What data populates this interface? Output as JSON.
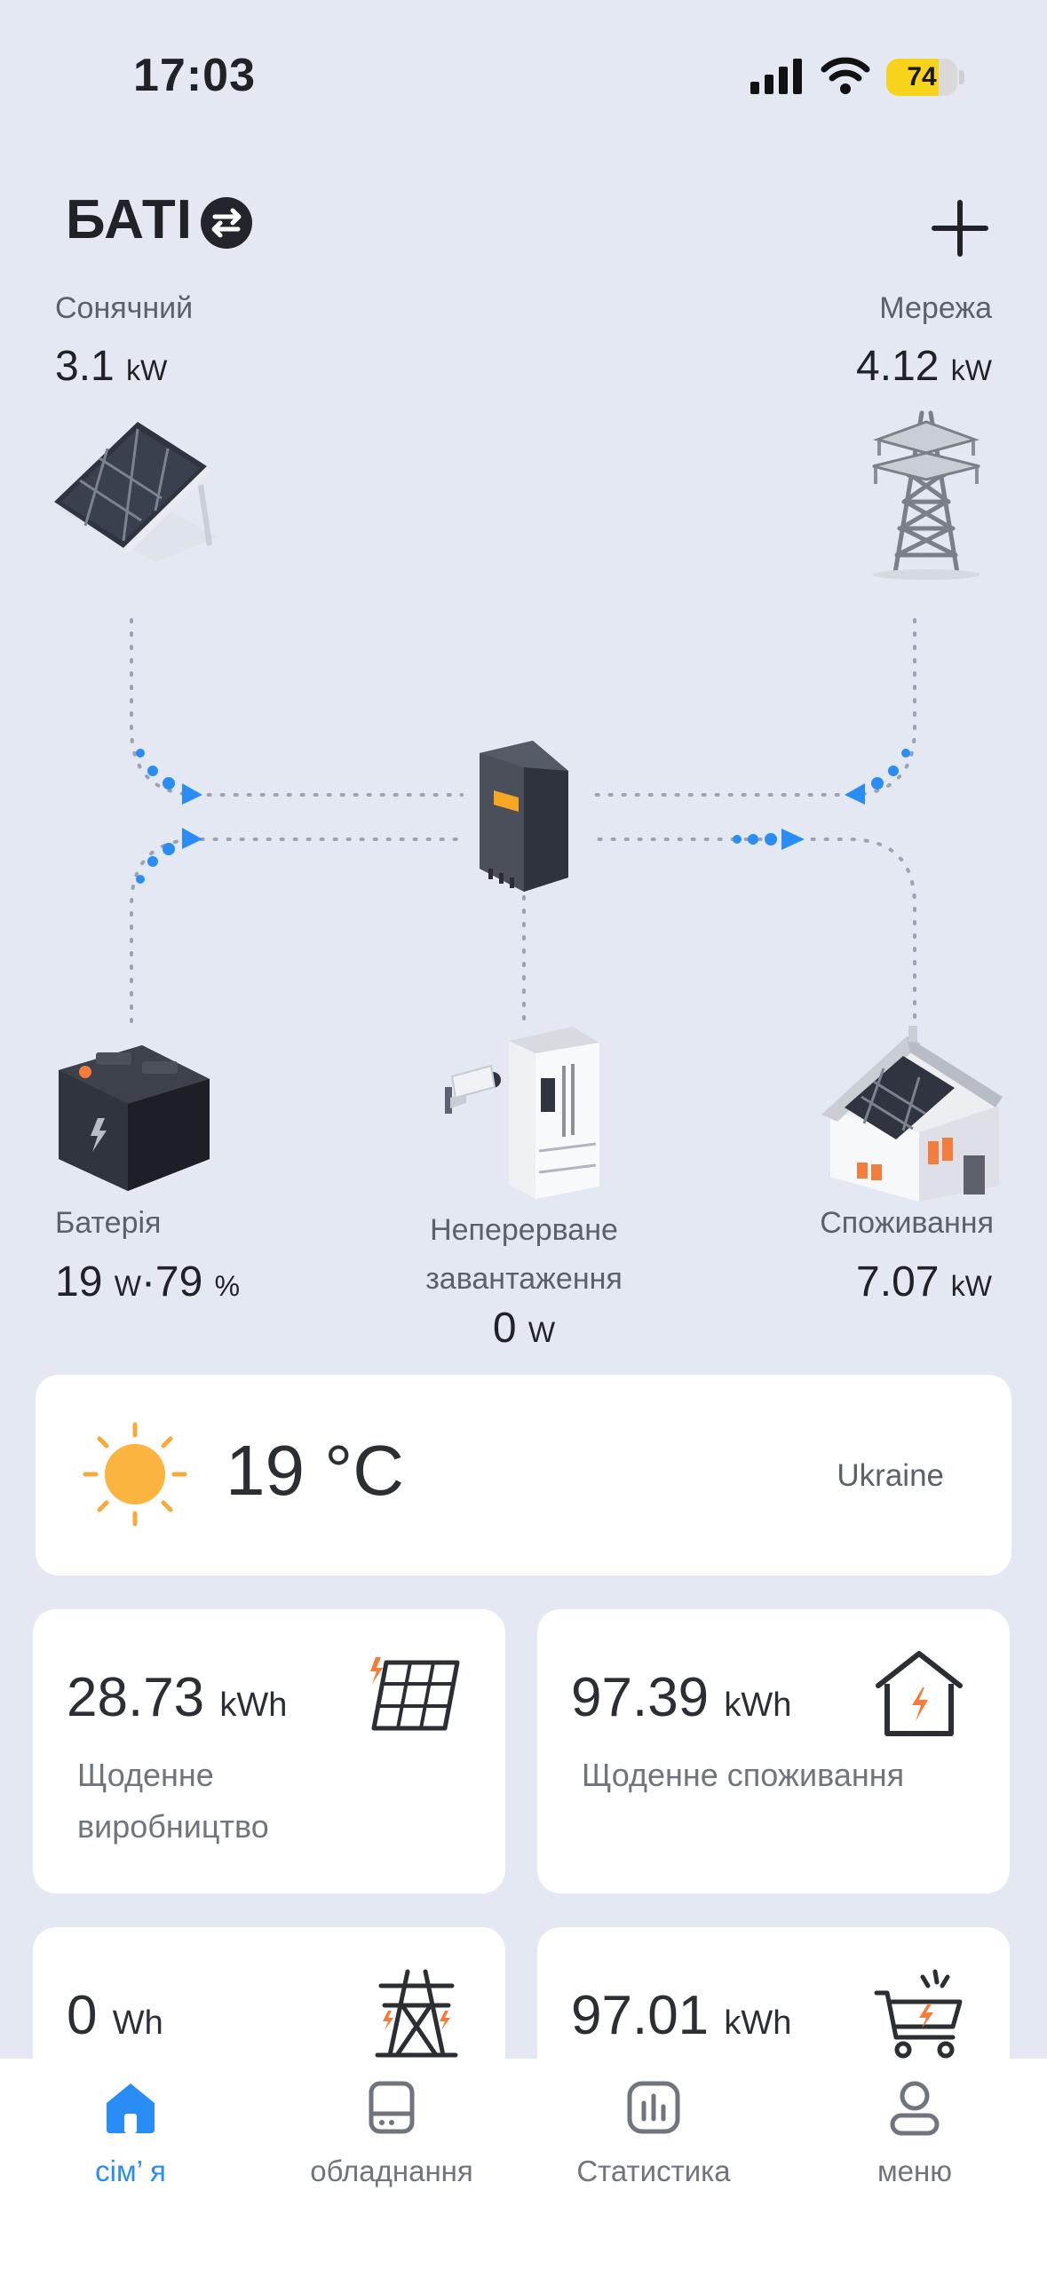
{
  "status_bar": {
    "time": "17:03",
    "battery_percent": "74"
  },
  "header": {
    "title": "БАТІ"
  },
  "flow": {
    "solar": {
      "label": "Сонячний",
      "value": "3.1",
      "unit": "kW"
    },
    "grid": {
      "label": "Мережа",
      "value": "4.12",
      "unit": "kW"
    },
    "battery": {
      "label": "Батерія",
      "power": "19",
      "power_unit": "W",
      "separator": "·",
      "soc": "79",
      "soc_unit": "%"
    },
    "ups_load": {
      "label_line1": "Неперерване",
      "label_line2": "завантаження",
      "value": "0",
      "unit": "W"
    },
    "consumption": {
      "label": "Споживання",
      "value": "7.07",
      "unit": "kW"
    }
  },
  "weather": {
    "temperature": "19 °C",
    "location": "Ukraine",
    "icon": "sun-icon"
  },
  "stats": {
    "daily_production": {
      "value": "28.73",
      "unit": "kWh",
      "label_line1": "Щоденне",
      "label_line2": "виробництво",
      "icon": "solar-panel-icon"
    },
    "daily_consumption": {
      "value": "97.39",
      "unit": "kWh",
      "label": "Щоденне споживання",
      "icon": "house-power-icon"
    },
    "grid_energy": {
      "value": "0",
      "unit": "Wh",
      "icon": "power-tower-icon"
    },
    "purchased_energy": {
      "value": "97.01",
      "unit": "kWh",
      "icon": "cart-power-icon"
    }
  },
  "tabs": [
    {
      "label": "сім’ я",
      "icon": "home-icon",
      "active": true
    },
    {
      "label": "обладнання",
      "icon": "device-icon",
      "active": false
    },
    {
      "label": "Статистика",
      "icon": "chart-icon",
      "active": false
    },
    {
      "label": "меню",
      "icon": "user-icon",
      "active": false
    }
  ],
  "colors": {
    "accent": "#2a8cf5",
    "background": "#e3e8f2",
    "battery_yellow": "#f7d31b",
    "orange": "#f57c3a"
  }
}
